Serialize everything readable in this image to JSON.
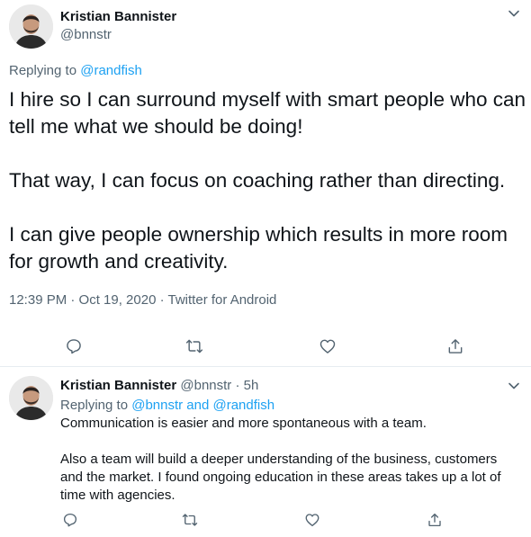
{
  "main_tweet": {
    "author_name": "Kristian Bannister",
    "author_handle": "@bnnstr",
    "replying_prefix": "Replying to",
    "replying_to": "@randfish",
    "text_paragraphs": [
      "I hire so I can surround myself with smart people who can tell me what we should be doing!",
      "That way, I can focus on coaching rather than directing.",
      "I can give people ownership which results in more room for growth and creativity."
    ],
    "timestamp": "12:39 PM · Oct 19, 2020",
    "source": "Twitter for Android",
    "actions": [
      "reply-icon",
      "retweet-icon",
      "like-icon",
      "share-icon"
    ]
  },
  "reply_tweet": {
    "author_name": "Kristian Bannister",
    "author_handle": "@bnnstr",
    "time_ago": "5h",
    "replying_prefix": "Replying to",
    "replying_to": "@bnnstr and @randfish",
    "text_paragraphs": [
      "Communication is easier and more spontaneous with a team.",
      "Also a team will build a deeper understanding of the business, customers and the market. I found ongoing education in these areas takes up a lot of time with agencies."
    ],
    "actions": [
      "reply-icon",
      "retweet-icon",
      "like-icon",
      "share-icon"
    ]
  },
  "colors": {
    "text_primary": "#0f1419",
    "text_secondary": "#536471",
    "link": "#1da1f2",
    "divider": "#e6ecf0",
    "icon": "#536471"
  }
}
